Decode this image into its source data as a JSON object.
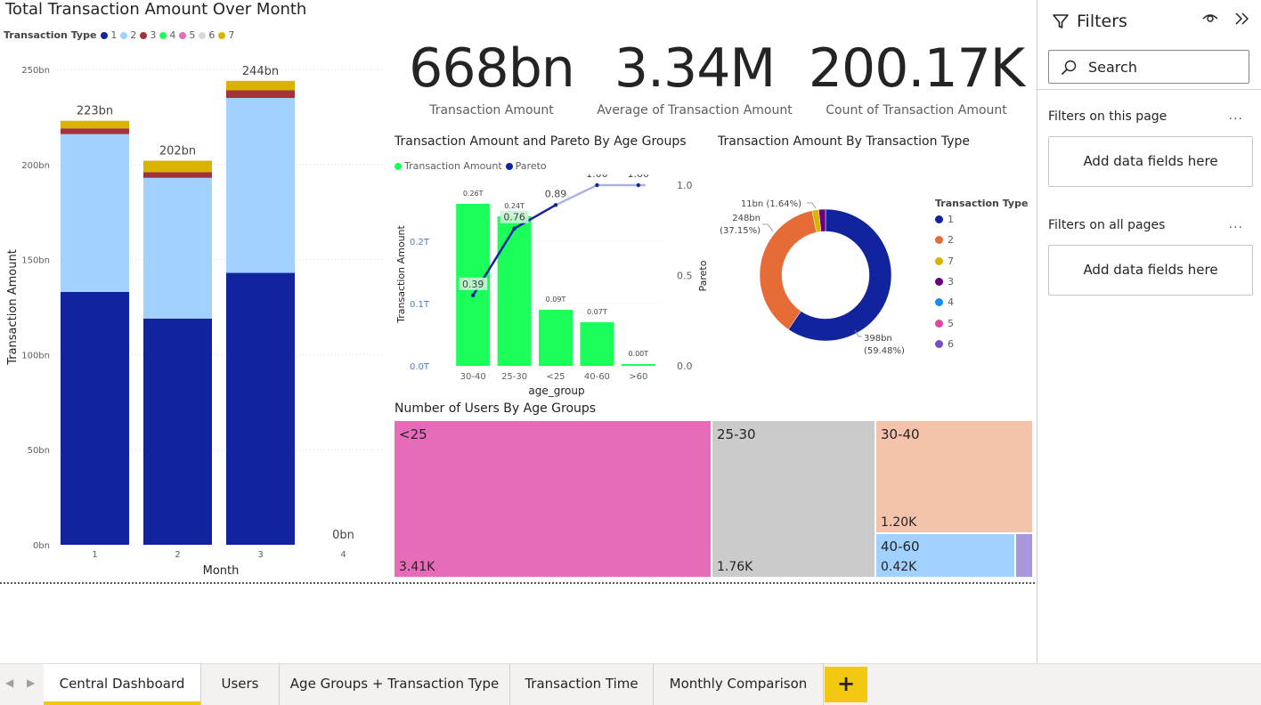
{
  "month_chart": {
    "title": "Total Transaction Amount Over Month",
    "legend_title": "Transaction Type",
    "legend": [
      {
        "label": "1",
        "color": "#12239e"
      },
      {
        "label": "2",
        "color": "#a0d1ff"
      },
      {
        "label": "3",
        "color": "#a4323a"
      },
      {
        "label": "4",
        "color": "#1aff5a"
      },
      {
        "label": "5",
        "color": "#e66cb4"
      },
      {
        "label": "6",
        "color": "#d9d9d9"
      },
      {
        "label": "7",
        "color": "#d9b300"
      }
    ],
    "y_axis_label": "Transaction Amount",
    "x_axis_label": "Month",
    "y_ticks": [
      "250bn",
      "200bn",
      "150bn",
      "100bn",
      "50bn",
      "0bn"
    ]
  },
  "kpis": [
    {
      "value": "668bn",
      "label": "Transaction Amount"
    },
    {
      "value": "3.34M",
      "label": "Average of Transaction Amount"
    },
    {
      "value": "200.17K",
      "label": "Count of Transaction Amount"
    }
  ],
  "pareto_chart": {
    "title": "Transaction Amount and Pareto By Age Groups",
    "legend": [
      {
        "label": "Transaction Amount",
        "color": "#1aff5a"
      },
      {
        "label": "Pareto",
        "color": "#12239e"
      }
    ],
    "y_left_label": "Transaction Amount",
    "y_right_label": "Pareto",
    "x_axis_label": "age_group",
    "y_left_ticks": [
      "0.2T",
      "0.1T",
      "0.0T"
    ],
    "y_right_ticks": [
      "1.0",
      "0.5",
      "0.0"
    ]
  },
  "donut_chart": {
    "title": "Transaction Amount By Transaction Type",
    "legend_title": "Transaction Type",
    "legend": [
      {
        "label": "1",
        "color": "#12239e"
      },
      {
        "label": "2",
        "color": "#e66c37"
      },
      {
        "label": "7",
        "color": "#d9b300"
      },
      {
        "label": "3",
        "color": "#6b007b"
      },
      {
        "label": "4",
        "color": "#118dff"
      },
      {
        "label": "5",
        "color": "#e044a7"
      },
      {
        "label": "6",
        "color": "#744ec2"
      }
    ],
    "labels": {
      "t7": "11bn (1.64%)",
      "t2_value": "248bn",
      "t2_pct": "(37.15%)",
      "t1_value": "398bn",
      "t1_pct": "(59.48%)"
    }
  },
  "treemap": {
    "title": "Number of Users By Age Groups",
    "tiles": [
      {
        "label": "<25",
        "value": "3.41K",
        "color": "#e66cb9"
      },
      {
        "label": "25-30",
        "value": "1.76K",
        "color": "#cbcbcb"
      },
      {
        "label": "30-40",
        "value": "1.20K",
        "color": "#f4c3ab"
      },
      {
        "label": "40-60",
        "value": "0.42K",
        "color": "#a0d1ff"
      },
      {
        "label": "",
        "value": "",
        "color": "#a997dd"
      }
    ]
  },
  "chart_data": [
    {
      "type": "bar",
      "title": "Total Transaction Amount Over Month",
      "xlabel": "Month",
      "ylabel": "Transaction Amount",
      "ylim": [
        0,
        250
      ],
      "units": "bn",
      "categories": [
        "1",
        "2",
        "3",
        "4"
      ],
      "totals": [
        "223bn",
        "202bn",
        "244bn",
        "0bn"
      ],
      "series": [
        {
          "name": "1",
          "color": "#12239e",
          "values": [
            133,
            119,
            143,
            0
          ]
        },
        {
          "name": "2",
          "color": "#a0d1ff",
          "values": [
            83,
            74,
            92,
            0
          ]
        },
        {
          "name": "3",
          "color": "#a4323a",
          "values": [
            3,
            3,
            4,
            0
          ]
        },
        {
          "name": "7",
          "color": "#d9b300",
          "values": [
            4,
            6,
            5,
            0
          ]
        }
      ]
    },
    {
      "type": "bar",
      "title": "Transaction Amount and Pareto By Age Groups",
      "xlabel": "age_group",
      "ylabel": "Transaction Amount",
      "categories": [
        "30-40",
        "25-30",
        "<25",
        "40-60",
        ">60"
      ],
      "bar_values_T": [
        0.26,
        0.24,
        0.09,
        0.07,
        0.0
      ],
      "bar_labels": [
        "0.26T",
        "0.24T",
        "0.09T",
        "0.07T",
        "0.00T"
      ],
      "ylim_left": [
        0,
        0.29
      ],
      "pareto_values": [
        0.39,
        0.76,
        0.89,
        1.0,
        1.0
      ],
      "pareto_labels": [
        "0.39",
        "0.76",
        "0.89",
        "1.00",
        "1.00"
      ],
      "ylim_right": [
        0,
        1.0
      ]
    },
    {
      "type": "pie",
      "title": "Transaction Amount By Transaction Type",
      "slices": [
        {
          "name": "1",
          "value": 398,
          "percent": 59.48,
          "color": "#12239e"
        },
        {
          "name": "2",
          "value": 248,
          "percent": 37.15,
          "color": "#e66c37"
        },
        {
          "name": "7",
          "value": 11,
          "percent": 1.64,
          "color": "#d9b300"
        },
        {
          "name": "3",
          "value": 11,
          "percent": 1.65,
          "color": "#6b007b"
        }
      ]
    }
  ],
  "filters": {
    "title": "Filters",
    "search_placeholder": "Search",
    "page_section": "Filters on this page",
    "all_section": "Filters on all pages",
    "drop_label": "Add data fields here",
    "more": "..."
  },
  "tabs": [
    {
      "label": "Central Dashboard",
      "active": true
    },
    {
      "label": "Users",
      "active": false
    },
    {
      "label": "Age Groups + Transaction Type",
      "active": false
    },
    {
      "label": "Transaction Time",
      "active": false
    },
    {
      "label": "Monthly Comparison",
      "active": false
    }
  ],
  "add_tab": "+"
}
